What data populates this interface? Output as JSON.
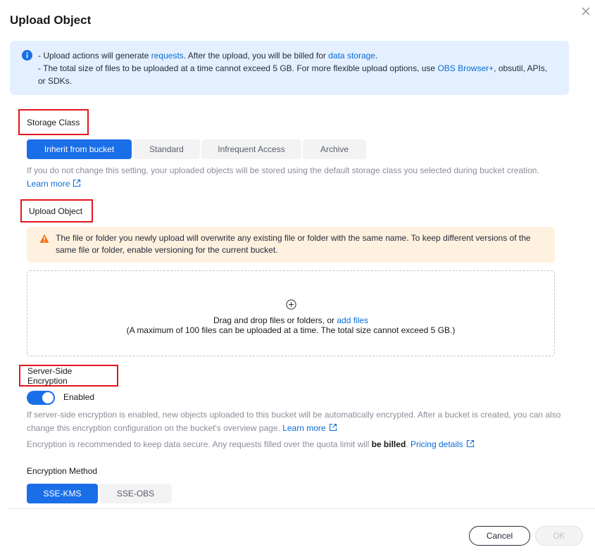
{
  "dialog": {
    "title": "Upload Object"
  },
  "notice": {
    "line1_pre": "- Upload actions will generate ",
    "line1_link1": "requests",
    "line1_mid": ". After the upload, you will be billed for ",
    "line1_link2": "data storage",
    "line1_post": ".",
    "line2_pre": "- The total size of files to be uploaded at a time cannot exceed 5 GB. For more flexible upload options, use ",
    "line2_link": "OBS Browser+",
    "line2_post": ", obsutil, APIs, or SDKs."
  },
  "storage_class": {
    "label": "Storage Class",
    "options": [
      "Inherit from bucket",
      "Standard",
      "Infrequent Access",
      "Archive"
    ],
    "selected": "Inherit from bucket",
    "help": "If you do not change this setting, your uploaded objects will be stored using the default storage class you selected during bucket creation.",
    "learn_more": "Learn more"
  },
  "upload": {
    "label": "Upload Object",
    "warning": "The file or folder you newly upload will overwrite any existing file or folder with the same name. To keep different versions of the same file or folder, enable versioning for the current bucket.",
    "drop_text": "Drag and drop files or folders, or ",
    "add_files": "add files",
    "limit_text": "(A maximum of 100 files can be uploaded at a time. The total size cannot exceed 5 GB.)"
  },
  "encryption": {
    "label": "Server-Side Encryption",
    "toggle_label": "Enabled",
    "enabled": true,
    "help": "If server-side encryption is enabled, new objects uploaded to this bucket will be automatically encrypted. After a bucket is created, you can also change this encryption configuration on the bucket's overview page. ",
    "learn_more": "Learn more",
    "note_pre": "Encryption is recommended to keep data secure. Any requests filled over the quota limit will ",
    "note_bold": "be billed",
    "note_post": ". ",
    "pricing": "Pricing details",
    "method_label": "Encryption Method",
    "methods": [
      "SSE-KMS",
      "SSE-OBS"
    ],
    "selected_method": "SSE-KMS"
  },
  "footer": {
    "cancel": "Cancel",
    "ok": "OK"
  },
  "colors": {
    "accent": "#1a6fe8",
    "link": "#0a6cd6",
    "highlight_border": "#e4151b",
    "info_bg": "#e4f0ff",
    "warn_bg": "#fff1e0"
  }
}
